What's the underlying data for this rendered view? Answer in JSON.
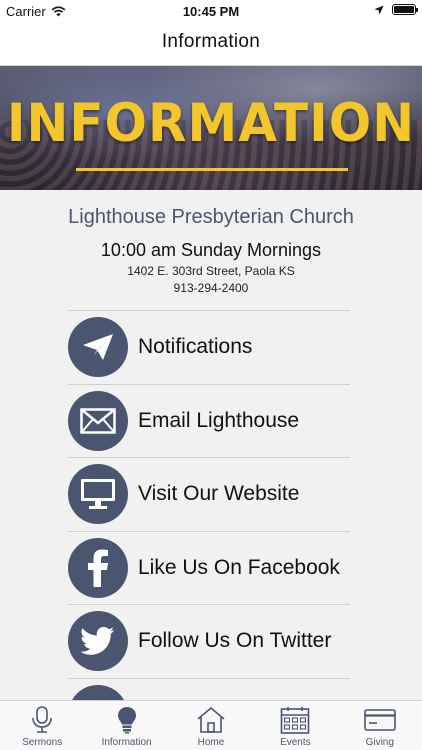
{
  "status_bar": {
    "carrier": "Carrier",
    "time": "10:45 PM"
  },
  "nav": {
    "title": "Information"
  },
  "hero": {
    "title": "INFORMATION"
  },
  "church": {
    "name": "Lighthouse Presbyterian Church",
    "service_time": "10:00 am Sunday Mornings",
    "address": "1402 E. 303rd Street, Paola KS",
    "phone": "913-294-2400"
  },
  "menu": {
    "items": [
      {
        "label": "Notifications",
        "icon": "paper-plane-icon"
      },
      {
        "label": "Email Lighthouse",
        "icon": "envelope-icon"
      },
      {
        "label": "Visit Our Website",
        "icon": "monitor-icon"
      },
      {
        "label": "Like Us On Facebook",
        "icon": "facebook-icon"
      },
      {
        "label": "Follow Us On Twitter",
        "icon": "twitter-icon"
      }
    ]
  },
  "tabs": [
    {
      "label": "Sermons",
      "icon": "microphone-icon"
    },
    {
      "label": "Information",
      "icon": "lightbulb-icon",
      "active": true
    },
    {
      "label": "Home",
      "icon": "house-icon"
    },
    {
      "label": "Events",
      "icon": "calendar-icon"
    },
    {
      "label": "Giving",
      "icon": "credit-card-icon"
    }
  ],
  "colors": {
    "accent": "#4a5670",
    "banner_text": "#f3c62b",
    "background": "#f1f1f1"
  }
}
